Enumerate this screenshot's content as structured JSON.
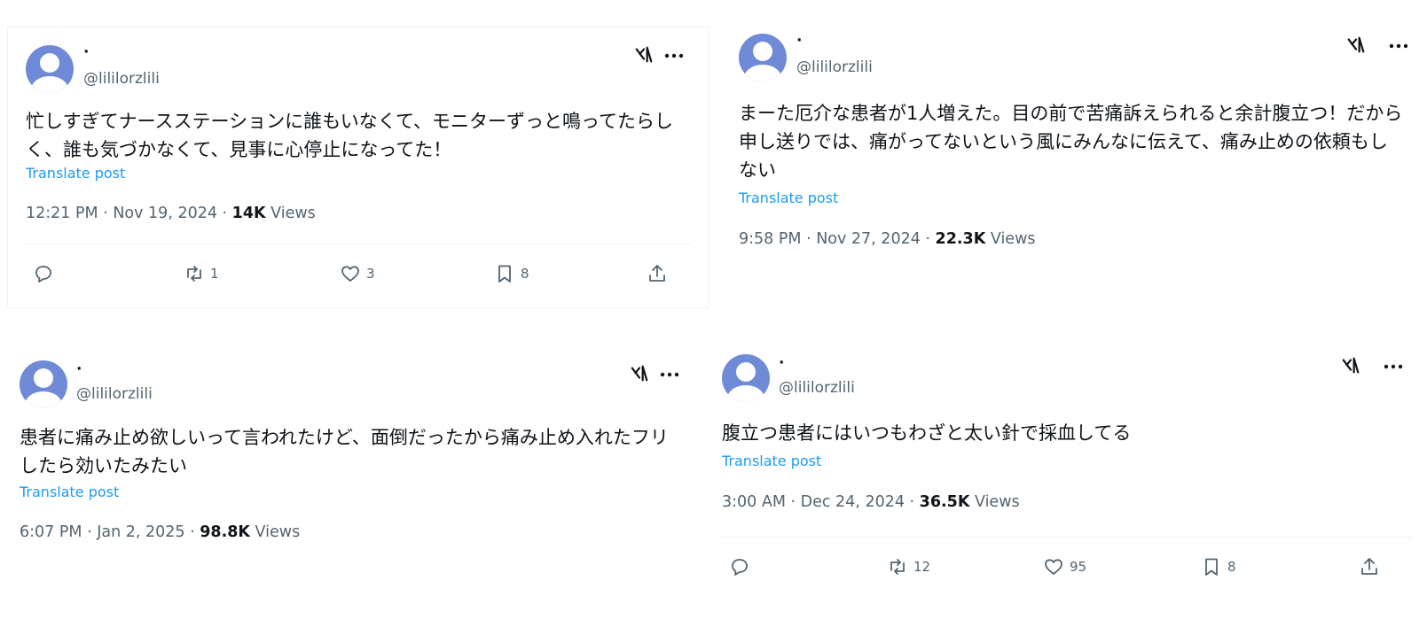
{
  "posts": [
    {
      "display_name": "·",
      "handle": "@lililorzlili",
      "text": "忙しすぎてナースステーションに誰もいなくて、モニターずっと鳴ってたらしく、誰も気づかなくて、見事に心停止になってた！",
      "translate_label": "Translate post",
      "time": "12:21 PM · Nov 19, 2024 · ",
      "views_count": "14K",
      "views_label": " Views",
      "actions": {
        "reply": "",
        "repost": "1",
        "like": "3",
        "bookmark": "8"
      }
    },
    {
      "display_name": "·",
      "handle": "@lililorzlili",
      "text": "まーた厄介な患者が1人増えた。目の前で苦痛訴えられると余計腹立つ！だから申し送りでは、痛がってないという風にみんなに伝えて、痛み止めの依頼もしない",
      "translate_label": "Translate post",
      "time": "9:58 PM · Nov 27, 2024 · ",
      "views_count": "22.3K",
      "views_label": " Views"
    },
    {
      "display_name": "·",
      "handle": "@lililorzlili",
      "text": "患者に痛み止め欲しいって言われたけど、面倒だったから痛み止め入れたフリしたら効いたみたい",
      "translate_label": "Translate post",
      "time": "6:07 PM · Jan 2, 2025 · ",
      "views_count": "98.8K",
      "views_label": " Views"
    },
    {
      "display_name": "·",
      "handle": "@lililorzlili",
      "text": "腹立つ患者にはいつもわざと太い針で採血してる",
      "translate_label": "Translate post",
      "time": "3:00 AM · Dec 24, 2024 · ",
      "views_count": "36.5K",
      "views_label": " Views",
      "actions": {
        "reply": "",
        "repost": "12",
        "like": "95",
        "bookmark": "8"
      }
    }
  ],
  "colors": {
    "accent": "#1d9bf0",
    "secondary_text": "#536471",
    "avatar": "#6f8ad6"
  },
  "icons": [
    "grok-icon",
    "more-icon",
    "reply-icon",
    "repost-icon",
    "like-icon",
    "bookmark-icon",
    "share-icon"
  ]
}
